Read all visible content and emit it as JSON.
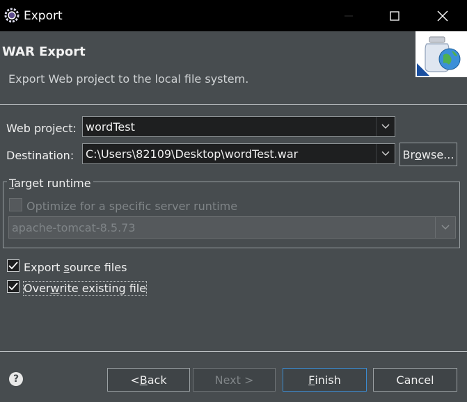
{
  "window": {
    "title": "Export",
    "minimize_glyph": "—",
    "maximize_glyph": "☐",
    "close_glyph": "✕"
  },
  "header": {
    "title": "WAR Export",
    "description": "Export Web project to the local file system."
  },
  "form": {
    "web_project_label": "Web project:",
    "web_project_value": "wordTest",
    "destination_label": "Destination:",
    "destination_value": "C:\\Users\\82109\\Desktop\\wordTest.war",
    "browse_pre": "Br",
    "browse_mnemonic": "o",
    "browse_post": "wse..."
  },
  "target_runtime": {
    "title_mnemonic": "T",
    "title_rest": "arget runtime",
    "optimize_label": "Optimize for a specific server runtime",
    "optimize_checked": false,
    "runtime_value": "apache-tomcat-8.5.73"
  },
  "options": {
    "export_source_pre": "Export ",
    "export_source_mnemonic": "s",
    "export_source_post": "ource files",
    "export_source_checked": true,
    "overwrite_pre": "Over",
    "overwrite_mnemonic": "w",
    "overwrite_post": "rite existing file",
    "overwrite_checked": true
  },
  "buttons": {
    "back_pre": "< ",
    "back_mnemonic": "B",
    "back_post": "ack",
    "next": "Next >",
    "finish_mnemonic": "F",
    "finish_post": "inish",
    "cancel": "Cancel"
  },
  "colors": {
    "background": "#474c4f",
    "titlebar": "#000000",
    "input_bg": "#1e1f20",
    "focus_border": "#3a8bd1"
  }
}
